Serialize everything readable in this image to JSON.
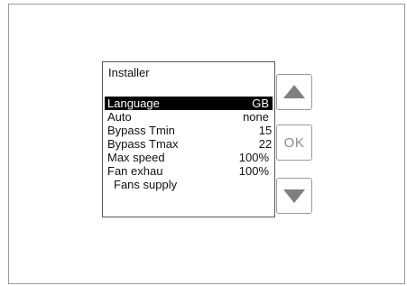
{
  "panel": {
    "title": "Installer",
    "menu": [
      {
        "label": "Language",
        "value": "GB",
        "selected": true
      },
      {
        "label": "Auto",
        "value": "none",
        "selected": false
      },
      {
        "label": "Bypass  Tmin",
        "value": "15",
        "selected": false
      },
      {
        "label": "Bypass  Tmax",
        "value": "22",
        "selected": false
      },
      {
        "label": "Max  speed",
        "value": "100%",
        "selected": false
      },
      {
        "label": "Fan  exhau",
        "value": "100%",
        "selected": false
      },
      {
        "label": "Fans supply",
        "value": "",
        "selected": false
      }
    ]
  },
  "buttons": {
    "up_icon": "triangle-up-icon",
    "ok_label": "OK",
    "down_icon": "triangle-down-icon"
  },
  "colors": {
    "selected_bg": "#000000",
    "selected_fg": "#ffffff",
    "button_glyph": "#7f7f7f"
  }
}
